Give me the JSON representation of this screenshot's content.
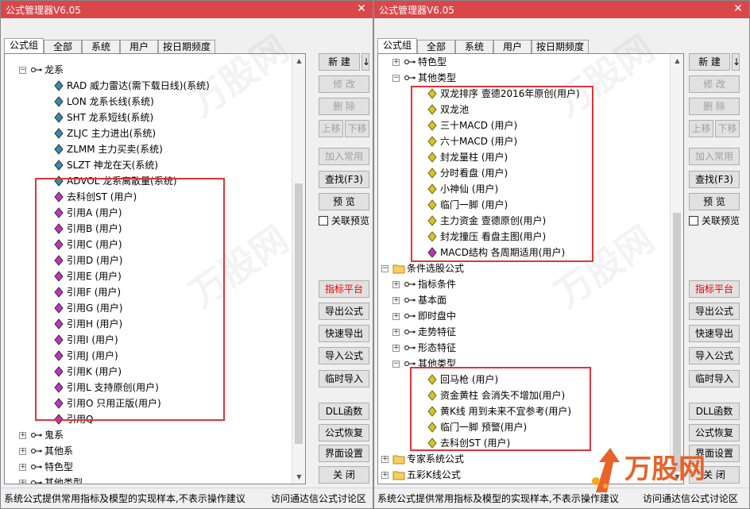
{
  "left": {
    "title": "公式管理器V6.05",
    "tabs": [
      "公式组",
      "全部",
      "系统",
      "用户",
      "按日期频度"
    ],
    "tree": [
      {
        "toggle": "-",
        "icon": "link",
        "label": "龙系",
        "level": 1
      },
      {
        "icon": "diamond-teal",
        "label": "RAD  威力雷达(需下载日线)(系统)",
        "level": 2
      },
      {
        "icon": "diamond-teal",
        "label": "LON  龙系长线(系统)",
        "level": 2
      },
      {
        "icon": "diamond-teal",
        "label": "SHT  龙系短线(系统)",
        "level": 2
      },
      {
        "icon": "diamond-teal",
        "label": "ZLJC  主力进出(系统)",
        "level": 2
      },
      {
        "icon": "diamond-teal",
        "label": "ZLMM  主力买卖(系统)",
        "level": 2
      },
      {
        "icon": "diamond-teal",
        "label": "SLZT  神龙在天(系统)",
        "level": 2
      },
      {
        "icon": "diamond-teal",
        "label": "ADVOL  龙系离散量(系统)",
        "level": 2
      },
      {
        "icon": "diamond-magenta",
        "label": "去科创ST  (用户)",
        "level": 2
      },
      {
        "icon": "diamond-magenta",
        "label": "引用A  (用户)",
        "level": 2
      },
      {
        "icon": "diamond-magenta",
        "label": "引用B  (用户)",
        "level": 2
      },
      {
        "icon": "diamond-magenta",
        "label": "引用C  (用户)",
        "level": 2
      },
      {
        "icon": "diamond-magenta",
        "label": "引用D  (用户)",
        "level": 2
      },
      {
        "icon": "diamond-magenta",
        "label": "引用E  (用户)",
        "level": 2
      },
      {
        "icon": "diamond-magenta",
        "label": "引用F  (用户)",
        "level": 2
      },
      {
        "icon": "diamond-magenta",
        "label": "引用G  (用户)",
        "level": 2
      },
      {
        "icon": "diamond-magenta",
        "label": "引用H  (用户)",
        "level": 2
      },
      {
        "icon": "diamond-magenta",
        "label": "引用I  (用户)",
        "level": 2
      },
      {
        "icon": "diamond-magenta",
        "label": "引用J  (用户)",
        "level": 2
      },
      {
        "icon": "diamond-magenta",
        "label": "引用K  (用户)",
        "level": 2
      },
      {
        "icon": "diamond-magenta",
        "label": "引用L  支持原创(用户)",
        "level": 2
      },
      {
        "icon": "diamond-magenta",
        "label": "引用O  只用正版(用户)",
        "level": 2
      },
      {
        "icon": "diamond-magenta",
        "label": "引用Q",
        "level": 2
      },
      {
        "toggle": "+",
        "icon": "link",
        "label": "鬼系",
        "level": 1
      },
      {
        "toggle": "+",
        "icon": "link",
        "label": "其他系",
        "level": 1
      },
      {
        "toggle": "+",
        "icon": "link",
        "label": "特色型",
        "level": 1
      },
      {
        "toggle": "+",
        "icon": "link",
        "label": "其他类型",
        "level": 1
      }
    ],
    "buttons": {
      "new": "新 建",
      "new_arrow": "↓",
      "modify": "修 改",
      "delete": "删 除",
      "up": "上移",
      "down": "下移",
      "add_common": "加入常用",
      "find": "查找(F3)",
      "preview": "预 览",
      "link_preview": "关联预览",
      "platform": "指标平台",
      "export": "导出公式",
      "quick_export": "快速导出",
      "import": "导入公式",
      "temp_import": "临时导入",
      "dll": "DLL函数",
      "restore": "公式恢复",
      "ui_settings": "界面设置",
      "close": "关 闭"
    },
    "status": "系统公式提供常用指标及模型的实现样本,不表示操作建议",
    "status_link": "访问通达信公式讨论区"
  },
  "right": {
    "title": "公式管理器V6.05",
    "tabs": [
      "公式组",
      "全部",
      "系统",
      "用户",
      "按日期频度"
    ],
    "tree": [
      {
        "toggle": "+",
        "icon": "link",
        "label": "特色型",
        "level": 1
      },
      {
        "toggle": "-",
        "icon": "link",
        "label": "其他类型",
        "level": 1
      },
      {
        "icon": "diamond-yellow",
        "label": "双龙排序  壹德2016年原创(用户)",
        "level": 2
      },
      {
        "icon": "diamond-yellow",
        "label": "双龙池",
        "level": 2
      },
      {
        "icon": "diamond-yellow",
        "label": "三十MACD  (用户)",
        "level": 2
      },
      {
        "icon": "diamond-yellow",
        "label": "六十MACD  (用户)",
        "level": 2
      },
      {
        "icon": "diamond-yellow",
        "label": "封龙量柱  (用户)",
        "level": 2
      },
      {
        "icon": "diamond-yellow",
        "label": "分时看盘  (用户)",
        "level": 2
      },
      {
        "icon": "diamond-yellow",
        "label": "小神仙  (用户)",
        "level": 2
      },
      {
        "icon": "diamond-yellow",
        "label": "临门一脚  (用户)",
        "level": 2
      },
      {
        "icon": "diamond-yellow",
        "label": "主力资金  壹德原创(用户)",
        "level": 2
      },
      {
        "icon": "diamond-yellow",
        "label": "封龙撞压  看盘主图(用户)",
        "level": 2
      },
      {
        "icon": "diamond-magenta",
        "label": "MACD结构  各周期适用(用户)",
        "level": 2
      },
      {
        "toggle": "-",
        "icon": "folder",
        "label": "条件选股公式",
        "level": 0
      },
      {
        "toggle": "+",
        "icon": "link",
        "label": "指标条件",
        "level": 1
      },
      {
        "toggle": "+",
        "icon": "link",
        "label": "基本面",
        "level": 1
      },
      {
        "toggle": "+",
        "icon": "link",
        "label": "即时盘中",
        "level": 1
      },
      {
        "toggle": "+",
        "icon": "link",
        "label": "走势特征",
        "level": 1
      },
      {
        "toggle": "+",
        "icon": "link",
        "label": "形态特征",
        "level": 1
      },
      {
        "toggle": "-",
        "icon": "link",
        "label": "其他类型",
        "level": 1
      },
      {
        "icon": "diamond-yellow",
        "label": "回马枪  (用户)",
        "level": 2
      },
      {
        "icon": "diamond-yellow",
        "label": "资金黄柱  会消失不增加(用户)",
        "level": 2
      },
      {
        "icon": "diamond-yellow",
        "label": "黄K线  用到未来不宜参考(用户)",
        "level": 2
      },
      {
        "icon": "diamond-yellow",
        "label": "临门一脚  预警(用户)",
        "level": 2
      },
      {
        "icon": "diamond-yellow",
        "label": "去科创ST  (用户)",
        "level": 2
      },
      {
        "toggle": "+",
        "icon": "folder",
        "label": "专家系统公式",
        "level": 0
      },
      {
        "toggle": "+",
        "icon": "folder",
        "label": "五彩K线公式",
        "level": 0
      }
    ],
    "buttons": {
      "new": "新 建",
      "new_arrow": "↓",
      "modify": "修 改",
      "delete": "删 除",
      "up": "上移",
      "down": "下移",
      "add_common": "加入常用",
      "find": "查找(F3)",
      "preview": "预 览",
      "link_preview": "关联预览",
      "platform": "指标平台",
      "export": "导出公式",
      "quick_export": "快速导出",
      "import": "导入公式",
      "temp_import": "临时导入",
      "dll": "DLL函数",
      "restore": "公式恢复",
      "ui_settings": "界面设置",
      "close": "关 闭"
    },
    "status": "系统公式提供常用指标及模型的实现样本,不表示操作建议",
    "status_link": "访问通达信公式讨论区"
  },
  "logo_text": "万股网",
  "colors": {
    "title_bar": "#d9474a",
    "highlight_box": "#e0343a",
    "platform_button_text": "#e00000",
    "logo": "#e8622a"
  }
}
